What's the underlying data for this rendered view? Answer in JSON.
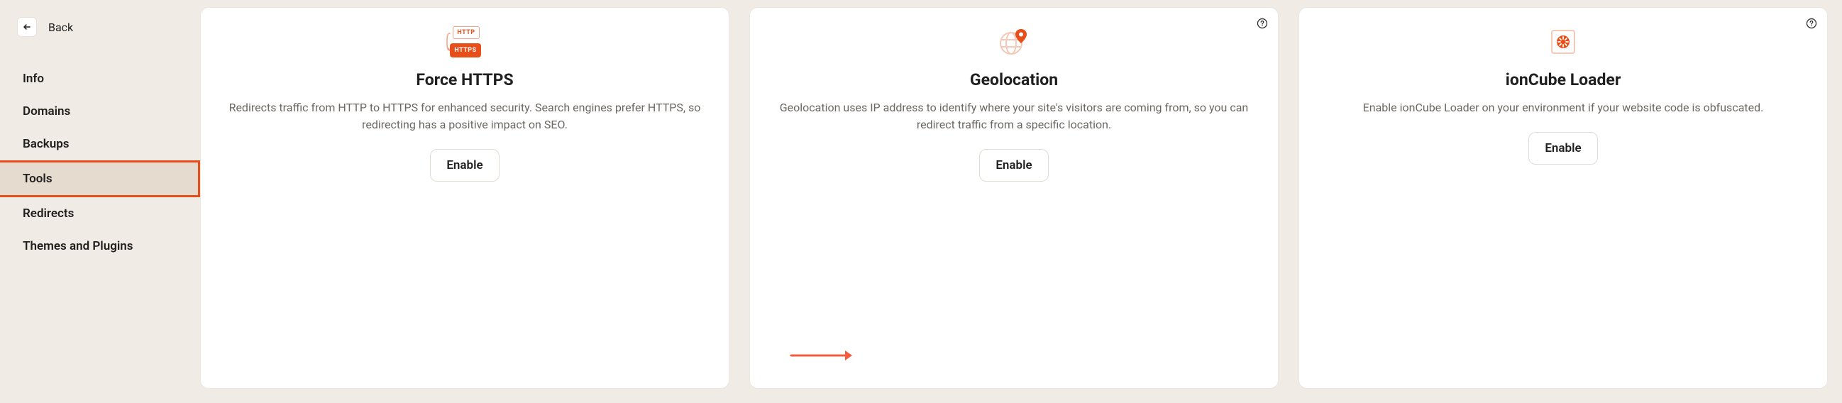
{
  "back": {
    "label": "Back"
  },
  "sidebar": {
    "items": [
      {
        "label": "Info",
        "active": false
      },
      {
        "label": "Domains",
        "active": false
      },
      {
        "label": "Backups",
        "active": false
      },
      {
        "label": "Tools",
        "active": true
      },
      {
        "label": "Redirects",
        "active": false
      },
      {
        "label": "Themes and Plugins",
        "active": false
      }
    ]
  },
  "cards": [
    {
      "title": "Force HTTPS",
      "description": "Redirects traffic from HTTP to HTTPS for enhanced security. Search engines prefer HTTPS, so redirecting has a positive impact on SEO.",
      "button": "Enable",
      "has_help": false,
      "icon_labels": {
        "http": "HTTP",
        "https": "HTTPS"
      }
    },
    {
      "title": "Geolocation",
      "description": "Geolocation uses IP address to identify where your site's visitors are coming from, so you can redirect traffic from a specific location.",
      "button": "Enable",
      "has_help": true
    },
    {
      "title": "ionCube Loader",
      "description": "Enable ionCube Loader on your environment if your website code is obfuscated.",
      "button": "Enable",
      "has_help": true
    }
  ]
}
